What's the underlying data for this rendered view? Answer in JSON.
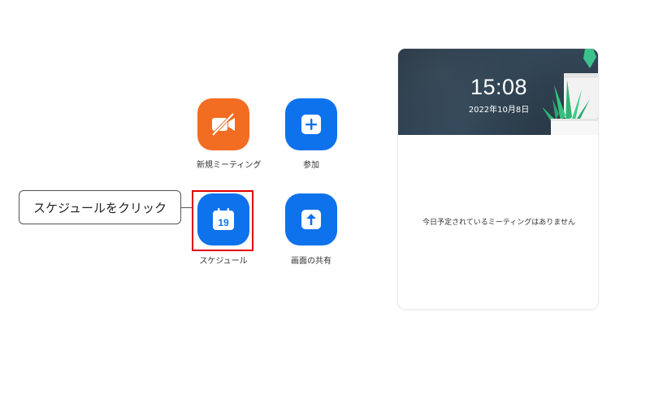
{
  "actions": {
    "new_meeting": {
      "label": "新規ミーティング",
      "icon": "video-off-icon",
      "color": "#f26d21",
      "has_dropdown": true
    },
    "join": {
      "label": "参加",
      "icon": "plus-icon",
      "color": "#0e72ed"
    },
    "schedule": {
      "label": "スケジュール",
      "icon": "calendar-icon",
      "calendar_day": "19",
      "color": "#0e72ed"
    },
    "share_screen": {
      "label": "画面の共有",
      "icon": "upload-arrow-icon",
      "color": "#0e72ed"
    }
  },
  "annotation": {
    "callout_text": "スケジュールをクリック",
    "highlight_color": "#e00000"
  },
  "panel": {
    "time": "15:08",
    "date": "2022年10月8日",
    "empty_message": "今日予定されているミーティングはありません"
  }
}
